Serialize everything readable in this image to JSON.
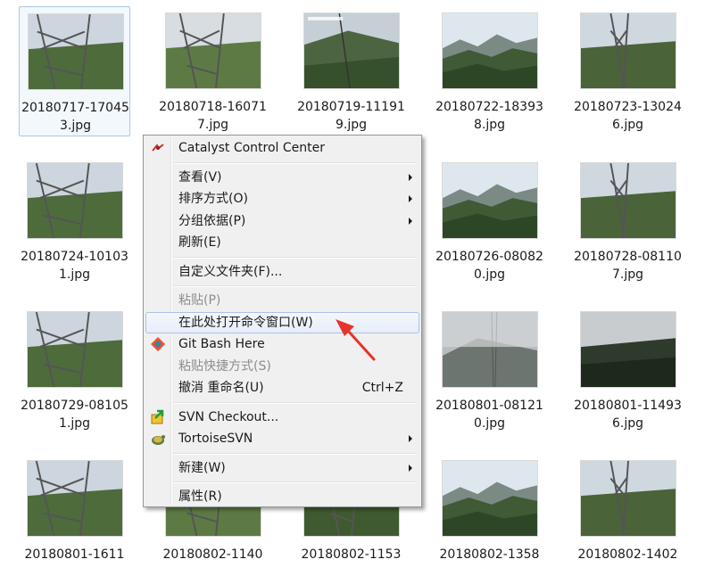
{
  "files": [
    {
      "name": "20180717-170453.jpg",
      "selected": true,
      "scene": "tower"
    },
    {
      "name": "20180718-160717.jpg",
      "scene": "tower"
    },
    {
      "name": "20180719-111919.jpg",
      "scene": "camera"
    },
    {
      "name": "20180722-183938.jpg",
      "scene": "mountain"
    },
    {
      "name": "20180723-130246.jpg",
      "scene": "tower"
    },
    {
      "name": "20180724-101031.jpg",
      "scene": "tower"
    },
    {
      "name": "",
      "scene": "hidden"
    },
    {
      "name": "",
      "scene": "hidden"
    },
    {
      "name": "20180726-080820.jpg",
      "scene": "mountain"
    },
    {
      "name": "20180728-081107.jpg",
      "scene": "tower"
    },
    {
      "name": "20180729-081051.jpg",
      "scene": "tower"
    },
    {
      "name": "",
      "scene": "hidden"
    },
    {
      "name": "",
      "scene": "hidden"
    },
    {
      "name": "20180801-081210.jpg",
      "scene": "fog"
    },
    {
      "name": "20180801-114936.jpg",
      "scene": "dark"
    },
    {
      "name": "20180801-1611",
      "scene": "tower"
    },
    {
      "name": "20180802-1140",
      "scene": "tower"
    },
    {
      "name": "20180802-1153",
      "scene": "tower"
    },
    {
      "name": "20180802-1358",
      "scene": "mountain"
    },
    {
      "name": "20180802-1402",
      "scene": "tower"
    }
  ],
  "menu": {
    "items": [
      {
        "type": "item",
        "label": "Catalyst Control Center",
        "icon": "catalyst-icon",
        "name": "menu-catalyst-control-center"
      },
      {
        "type": "sep"
      },
      {
        "type": "item",
        "label": "查看(V)",
        "submenu": true,
        "name": "menu-view"
      },
      {
        "type": "item",
        "label": "排序方式(O)",
        "submenu": true,
        "name": "menu-sort-by"
      },
      {
        "type": "item",
        "label": "分组依据(P)",
        "submenu": true,
        "name": "menu-group-by"
      },
      {
        "type": "item",
        "label": "刷新(E)",
        "name": "menu-refresh"
      },
      {
        "type": "sep"
      },
      {
        "type": "item",
        "label": "自定义文件夹(F)...",
        "name": "menu-customize-folder"
      },
      {
        "type": "sep"
      },
      {
        "type": "item",
        "label": "粘贴(P)",
        "disabled": true,
        "name": "menu-paste"
      },
      {
        "type": "item",
        "label": "在此处打开命令窗口(W)",
        "hover": true,
        "name": "menu-open-command-window"
      },
      {
        "type": "item",
        "label": "Git Bash Here",
        "icon": "git-icon",
        "name": "menu-git-bash-here"
      },
      {
        "type": "item",
        "label": "粘贴快捷方式(S)",
        "disabled": true,
        "name": "menu-paste-shortcut"
      },
      {
        "type": "item",
        "label": "撤消 重命名(U)",
        "shortcut": "Ctrl+Z",
        "name": "menu-undo-rename"
      },
      {
        "type": "sep"
      },
      {
        "type": "item",
        "label": "SVN Checkout...",
        "icon": "svn-checkout-icon",
        "name": "menu-svn-checkout"
      },
      {
        "type": "item",
        "label": "TortoiseSVN",
        "icon": "tortoisesvn-icon",
        "submenu": true,
        "name": "menu-tortoisesvn"
      },
      {
        "type": "sep"
      },
      {
        "type": "item",
        "label": "新建(W)",
        "submenu": true,
        "name": "menu-new"
      },
      {
        "type": "sep"
      },
      {
        "type": "item",
        "label": "属性(R)",
        "name": "menu-properties"
      }
    ]
  },
  "colors": {
    "annotation_arrow": "#e8322d",
    "hover_border": "#a9c3e6",
    "selected_border": "#a8c8ea"
  }
}
